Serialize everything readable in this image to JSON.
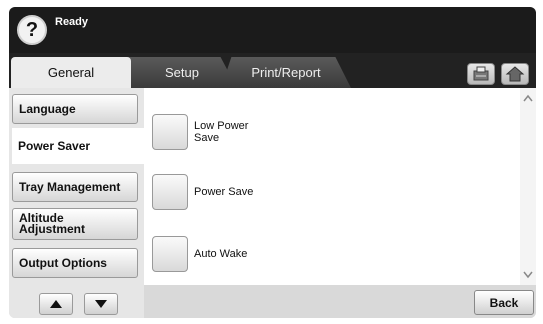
{
  "status": {
    "text": "Ready",
    "help_glyph": "?"
  },
  "tabs": [
    {
      "label": "General"
    },
    {
      "label": "Setup"
    },
    {
      "label": "Print/Report"
    }
  ],
  "side_menu": [
    {
      "label": "Language"
    },
    {
      "label": "Power Saver"
    },
    {
      "label": "Tray Management"
    },
    {
      "label": "Altitude Adjustment"
    },
    {
      "label": "Output Options"
    }
  ],
  "options": [
    {
      "label": "Low Power Save"
    },
    {
      "label": "Power Save"
    },
    {
      "label": "Auto Wake"
    }
  ],
  "back_label": "Back",
  "icons": {
    "job": "job-status-icon",
    "home": "home-icon",
    "up": "arrow-up-icon",
    "down": "arrow-down-icon"
  }
}
